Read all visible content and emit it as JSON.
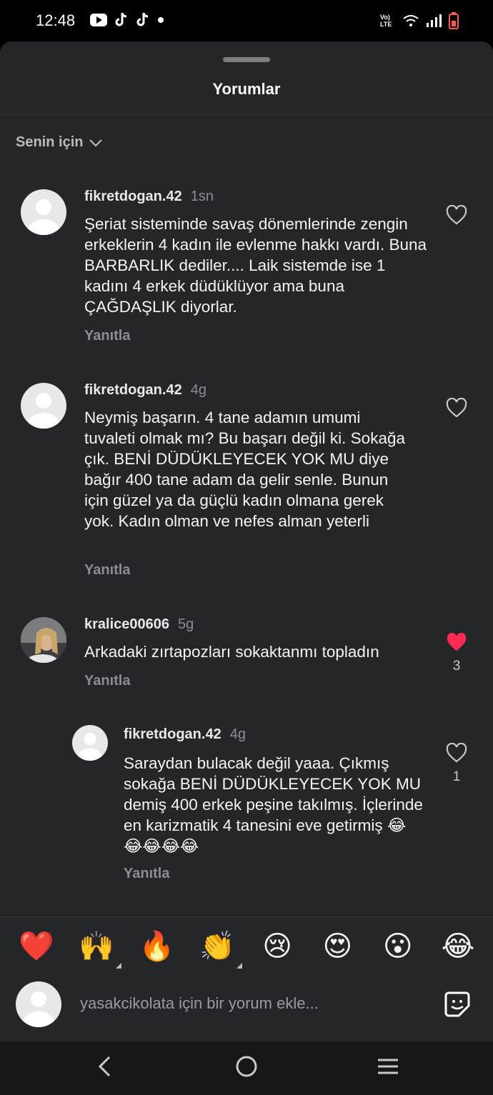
{
  "status": {
    "time": "12:48",
    "network": "Vo) LTE"
  },
  "header": {
    "title": "Yorumlar"
  },
  "filter": {
    "label": "Senin için"
  },
  "comments": [
    {
      "user": "fikretdogan.42",
      "time": "1sn",
      "text": "Şeriat sisteminde savaş dönemlerinde zengin erkeklerin 4 kadın ile evlenme hakkı vardı. Buna BARBARLIK dediler.... Laik sistemde ise 1 kadını 4 erkek düdüklüyor ama buna ÇAĞDAŞLIK diyorlar.",
      "reply": "Yanıtla",
      "likes": ""
    },
    {
      "user": "fikretdogan.42",
      "time": "4g",
      "text": "Neymiş başarın. 4 tane adamın umumi tuvaleti olmak mı? Bu başarı değil ki. Sokağa çık. BENİ DÜDÜKLEYECEK YOK MU diye bağır 400 tane adam da gelir senle. Bunun için güzel ya da güçlü kadın olmana gerek yok. Kadın olman ve nefes alman yeterli",
      "reply": "Yanıtla",
      "likes": ""
    },
    {
      "user": "kralice00606",
      "time": "5g",
      "text": "Arkadaki zırtapozları sokaktanmı topladın",
      "reply": "Yanıtla",
      "likes": "3",
      "liked": true
    },
    {
      "user": "fikretdogan.42",
      "time": "4g",
      "text": "Saraydan bulacak değil yaaa. Çıkmış sokağa BENİ DÜDÜKLEYECEK YOK MU demiş 400 erkek peşine takılmış. İçlerinde en karizmatik 4 tanesini eve getirmiş 😂😂😂😂😂",
      "reply": "Yanıtla",
      "likes": "1"
    }
  ],
  "quick_emojis": [
    "❤️",
    "🙌",
    "🔥",
    "👏",
    "😢",
    "😍",
    "😮",
    "😂"
  ],
  "input": {
    "placeholder": "yasakcikolata için bir yorum ekle..."
  },
  "colors": {
    "liked": "#fe2c55",
    "sheet_bg": "#25262a"
  }
}
